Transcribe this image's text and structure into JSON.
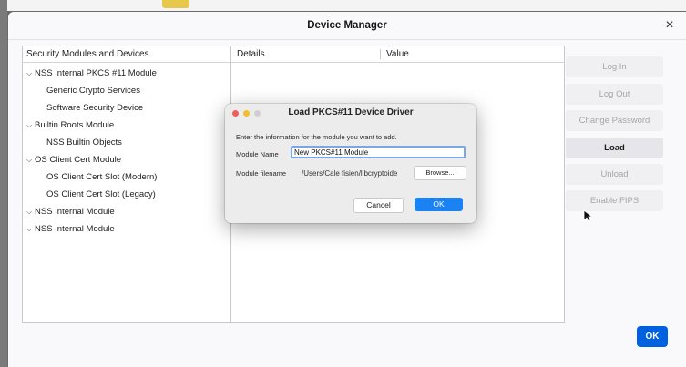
{
  "window": {
    "title": "Device Manager",
    "close_glyph": "×"
  },
  "top_tab": {
    "color": "#e7c84a"
  },
  "tree": {
    "header": "Security Modules and Devices",
    "items": [
      {
        "label": "NSS Internal PKCS #11 Module",
        "type": "module"
      },
      {
        "label": "Generic Crypto Services",
        "type": "slot"
      },
      {
        "label": "Software Security Device",
        "type": "slot"
      },
      {
        "label": "Builtin Roots Module",
        "type": "module"
      },
      {
        "label": "NSS Builtin Objects",
        "type": "slot"
      },
      {
        "label": "OS Client Cert Module",
        "type": "module"
      },
      {
        "label": "OS Client Cert Slot (Modern)",
        "type": "slot"
      },
      {
        "label": "OS Client Cert Slot (Legacy)",
        "type": "slot"
      },
      {
        "label": "NSS Internal Module",
        "type": "module"
      },
      {
        "label": "NSS Internal Module",
        "type": "module"
      }
    ]
  },
  "details": {
    "col_details": "Details",
    "col_value": "Value"
  },
  "side_buttons": {
    "log_in": "Log In",
    "log_out": "Log Out",
    "change_password": "Change Password",
    "load": "Load",
    "unload": "Unload",
    "enable_fips": "Enable FIPS"
  },
  "ok_label": "OK",
  "dialog": {
    "title": "Load PKCS#11 Device Driver",
    "prompt": "Enter the information for the module you want to add.",
    "module_name_label": "Module Name",
    "module_name_value": "New PKCS#11 Module",
    "module_filename_label": "Module filename",
    "module_filename_value": "/Users/Cale fisien/libcryptoide",
    "browse_label": "Browse...",
    "cancel_label": "Cancel",
    "ok_label": "OK"
  },
  "colors": {
    "accent": "#0061e0",
    "dialog_ok": "#1b82f3",
    "traffic_red": "#ee5f57",
    "traffic_yellow": "#f4bd2f"
  },
  "icons": [
    "close-icon",
    "chevron-down-icon",
    "mouse-pointer-icon"
  ]
}
